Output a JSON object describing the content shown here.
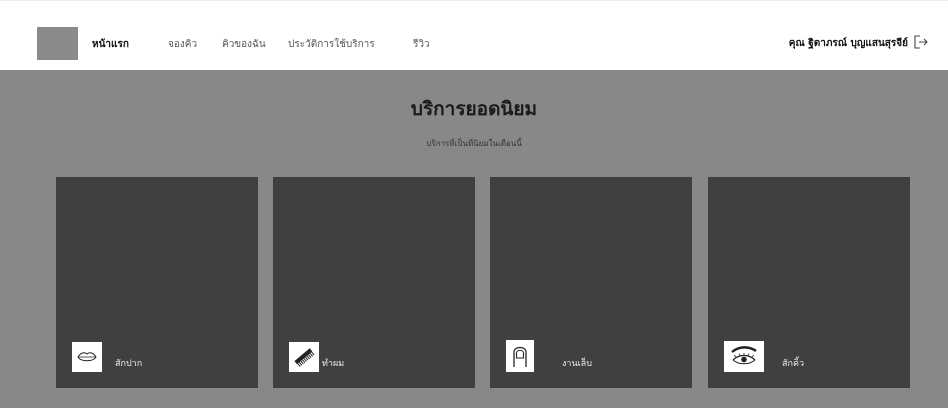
{
  "nav": {
    "items": [
      {
        "label": "หน้าแรก",
        "active": true
      },
      {
        "label": "จองคิว",
        "active": false
      },
      {
        "label": "คิวของฉัน",
        "active": false
      },
      {
        "label": "ประวัติการใช้บริการ",
        "active": false
      },
      {
        "label": "รีวิว",
        "active": false
      }
    ]
  },
  "user": {
    "name": "คุณ ฐิตาภรณ์ บุญแสนสุรจีย์",
    "logout_icon": "logout-icon"
  },
  "hero": {
    "title": "บริการยอดนิยม",
    "subtitle": "บริการที่เป็นที่นิยมในเดือนนี้"
  },
  "services": [
    {
      "label": "สักปาก",
      "icon": "lips-icon"
    },
    {
      "label": "ทำผม",
      "icon": "comb-icon"
    },
    {
      "label": "งานเล็บ",
      "icon": "nail-icon"
    },
    {
      "label": "สักคิ้ว",
      "icon": "eyebrow-icon"
    }
  ],
  "colors": {
    "hero_bg": "#888888",
    "card_bg": "#404040",
    "logo_bg": "#8a8a8a"
  }
}
